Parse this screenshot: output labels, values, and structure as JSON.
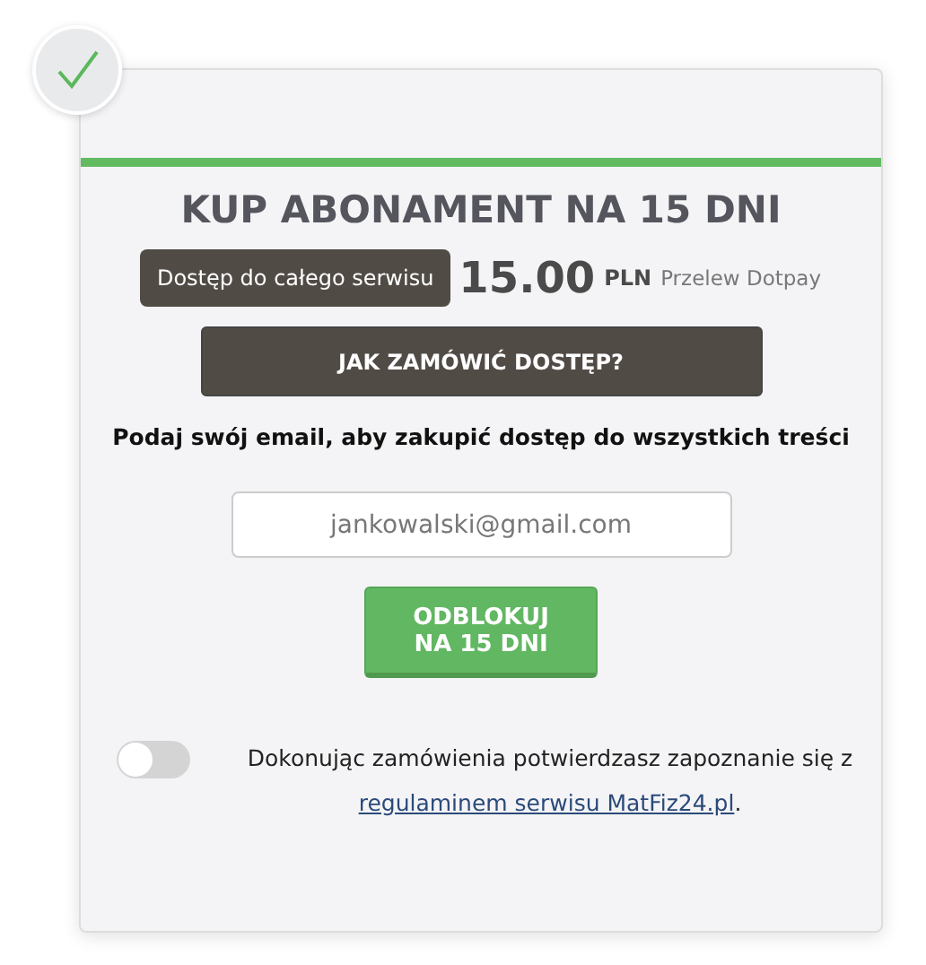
{
  "status": {
    "confirmed": true
  },
  "title": "KUP ABONAMENT NA 15 DNI",
  "offer": {
    "label": "Dostęp do całego serwisu",
    "price": "15.00",
    "currency": "PLN",
    "method": "Przelew Dotpay"
  },
  "help_button": "JAK ZAMÓWIĆ DOSTĘP?",
  "prompt": "Podaj swój email, aby zakupić dostęp do wszystkich treści",
  "email": {
    "placeholder": "jankowalski@gmail.com"
  },
  "submit_button": "ODBLOKUJ NA 15 DNI",
  "consent": {
    "on": false,
    "text_before": "Dokonując zamówienia potwierdzasz zapoznanie się z",
    "link": "regulaminem serwisu MatFiz24.pl",
    "text_after": "."
  }
}
